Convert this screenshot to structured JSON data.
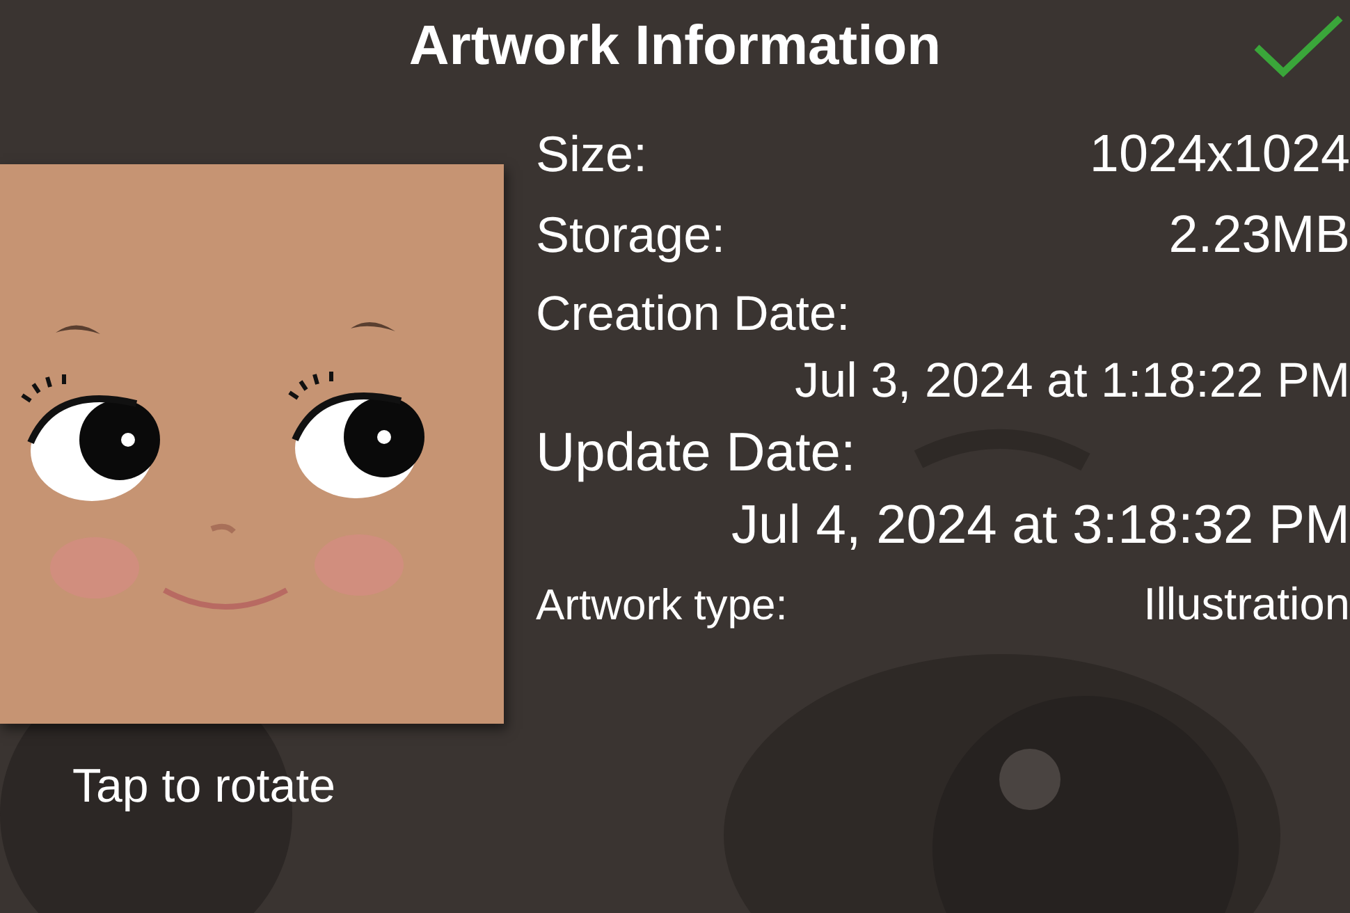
{
  "title": "Artwork Information",
  "artwork": {
    "caption": "Tap to rotate"
  },
  "details": [
    {
      "kind": "inline",
      "label": "Size:",
      "value": "1024x1024"
    },
    {
      "kind": "inline",
      "label": "Storage:",
      "value": "2.23MB"
    },
    {
      "kind": "stacked",
      "label": "Creation Date:",
      "value": "Jul 3, 2024 at 1:18:22 PM"
    },
    {
      "kind": "stacked_large",
      "label": "Update Date:",
      "value": "Jul 4, 2024 at 3:18:32 PM"
    },
    {
      "kind": "inline_small",
      "label": "Artwork type:",
      "value": "Illustration"
    }
  ]
}
